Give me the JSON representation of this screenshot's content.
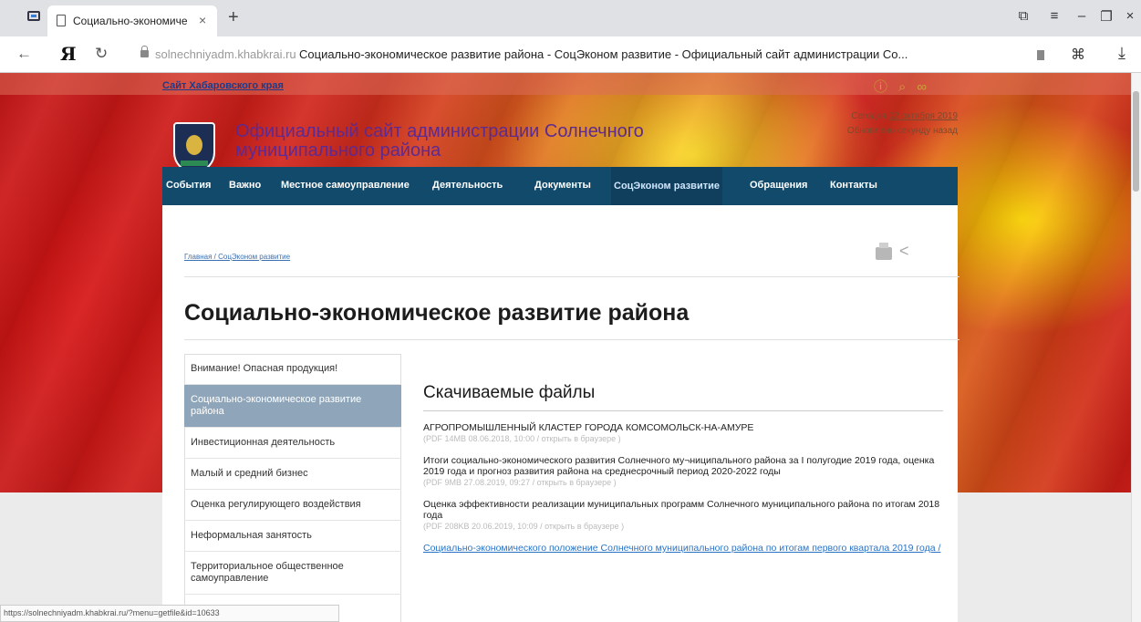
{
  "browser": {
    "tab_title": "Социально-экономиче",
    "tab_close": "×",
    "new_tab": "+",
    "url_domain": "solnechniyadm.khabkrai.ru",
    "page_title": "Социально-экономическое развитие района - СоцЭконом развитие - Официальный сайт администрации Со...",
    "yandex_logo": "Я"
  },
  "header": {
    "kray_link": "Сайт Хабаровского края",
    "site_title": "Официальный сайт администрации Солнечного муниципального района",
    "date_prefix": "Сегодня ",
    "date_value": "02 октября 2019",
    "updated": "Обновлено секунду назад"
  },
  "nav": {
    "items": [
      "События",
      "Важно",
      "Местное самоуправление",
      "Деятельность",
      "Документы",
      "СоцЭконом развитие",
      "Обращения",
      "Контакты"
    ]
  },
  "breadcrumb": "Главная / СоцЭконом развитие",
  "page_heading": "Социально-экономическое развитие района",
  "sidebar": {
    "items": [
      "Внимание! Опасная продукция!",
      "Социально-экономическое развитие района",
      "Инвестиционная деятельность",
      "Малый и средний бизнес",
      "Оценка регулирующего воздействия",
      "Неформальная занятость",
      "Территориальное общественное самоуправление"
    ]
  },
  "files": {
    "title": "Скачиваемые файлы",
    "list": [
      {
        "name": "АГРОПРОМЫШЛЕННЫЙ КЛАСТЕР ГОРОДА КОМСОМОЛЬСК-НА-АМУРЕ",
        "meta": "(PDF 14MB 08.06.2018, 10:00 / открыть в браузере )"
      },
      {
        "name": "Итоги социально-экономического развития Солнечного му¬ниципального района за I полугодие 2019 года, оценка 2019 года и прогноз развития района на среднесрочный период 2020-2022 годы",
        "meta": "(PDF 9MB 27.08.2019, 09:27 / открыть в браузере )"
      },
      {
        "name": "Оценка эффективности реализации муниципальных программ Солнечного муниципального района по итогам 2018 года",
        "meta": "(PDF 208KB 20.06.2019, 10:09 / открыть в браузере )"
      },
      {
        "name": "Социально-экономического положение Солнечного муниципального района по итогам первого квартала 2019 года /",
        "meta": ""
      }
    ]
  },
  "status_url": "https://solnechniyadm.khabkrai.ru/?menu=getfile&id=10633"
}
